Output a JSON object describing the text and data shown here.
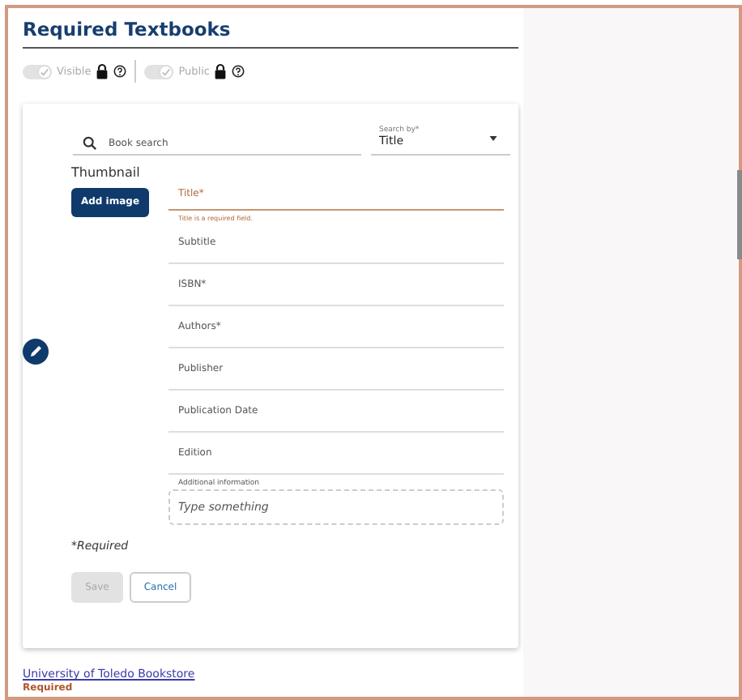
{
  "section": {
    "title": "Required Textbooks"
  },
  "toggles": [
    {
      "label": "Visible",
      "checked": true,
      "disabled": true,
      "locked": true
    },
    {
      "label": "Public",
      "checked": true,
      "disabled": true,
      "locked": true
    }
  ],
  "search": {
    "placeholder": "Book search"
  },
  "search_by": {
    "label": "Search by*",
    "value": "Title"
  },
  "thumbnail": {
    "label": "Thumbnail",
    "button": "Add image"
  },
  "fields": [
    {
      "placeholder": "Title*",
      "error": "Title is a required field."
    },
    {
      "placeholder": "Subtitle"
    },
    {
      "placeholder": "ISBN*"
    },
    {
      "placeholder": "Authors*"
    },
    {
      "placeholder": "Publisher"
    },
    {
      "placeholder": "Publication Date"
    },
    {
      "placeholder": "Edition"
    }
  ],
  "additional_info": {
    "label": "Additional information",
    "placeholder": "Type something"
  },
  "required_note": "*Required",
  "buttons": [
    {
      "label": "Save",
      "kind": "primary",
      "disabled": true
    },
    {
      "label": "Cancel",
      "kind": "secondary",
      "disabled": false
    }
  ],
  "footer": {
    "link": "University of Toledo Bookstore",
    "status": "Required"
  }
}
